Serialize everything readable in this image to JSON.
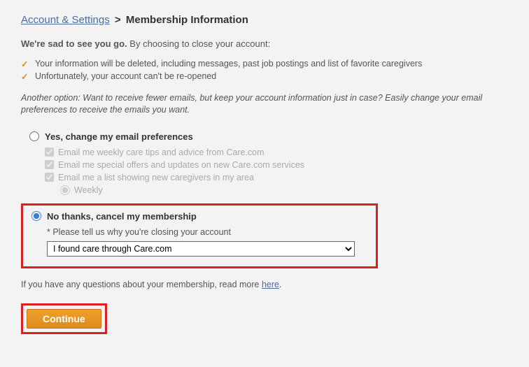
{
  "breadcrumb": {
    "link_text": "Account & Settings",
    "separator": ">",
    "current": "Membership Information"
  },
  "intro": {
    "bold": "We're sad to see you go.",
    "rest": " By choosing to close your account:"
  },
  "bullets": [
    "Your information will be deleted, including messages, past job postings and list of favorite caregivers",
    "Unfortunately, your account can't be re-opened"
  ],
  "note": "Another option: Want to receive fewer emails, but keep your account information just in case? Easily change your email preferences to receive the emails you want.",
  "option_yes": {
    "label": "Yes, change my email preferences",
    "checks": [
      "Email me weekly care tips and advice from Care.com",
      "Email me special offers and updates on new Care.com services",
      "Email me a list showing new caregivers in my area"
    ],
    "frequency": "Weekly"
  },
  "option_no": {
    "label": "No thanks, cancel my membership",
    "reason_label": "* Please tell us why you're closing your account",
    "reason_selected": "I found care through Care.com"
  },
  "footer": {
    "text_before": "If you have any questions about your membership, read more ",
    "link": "here",
    "text_after": "."
  },
  "continue_label": "Continue"
}
